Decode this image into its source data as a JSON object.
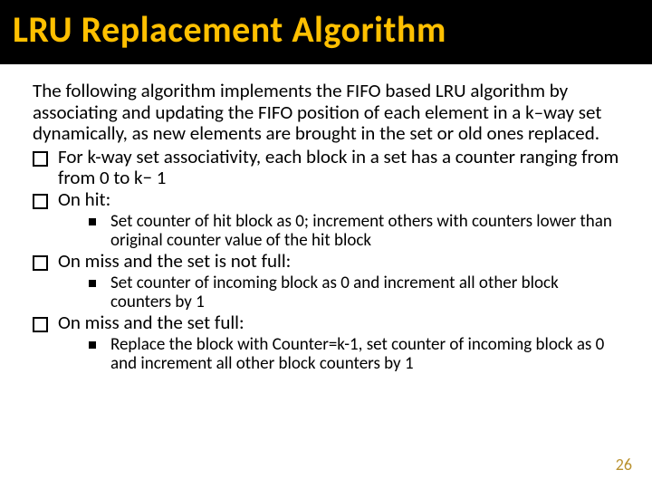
{
  "title": "LRU Replacement Algorithm",
  "intro": "The following algorithm implements the FIFO based LRU algorithm by associating and updating the FIFO position of each element in a k–way set dynamically, as new elements are brought in the set or old ones replaced.",
  "b1": "For k-way set associativity, each block in a set has a counter ranging from from 0 to k− 1",
  "b2": "On hit:",
  "b2s1": "Set counter of hit  block as 0; increment others with counters lower than original counter value of the hit block",
  "b3": "On miss and the set is not full:",
  "b3s1": "Set counter of incoming block as 0 and increment all other block counters by 1",
  "b4": "On miss and the set full:",
  "b4s1": "Replace the block with Counter=k-1, set counter of incoming block as 0 and increment all other block counters by 1",
  "page": "26"
}
